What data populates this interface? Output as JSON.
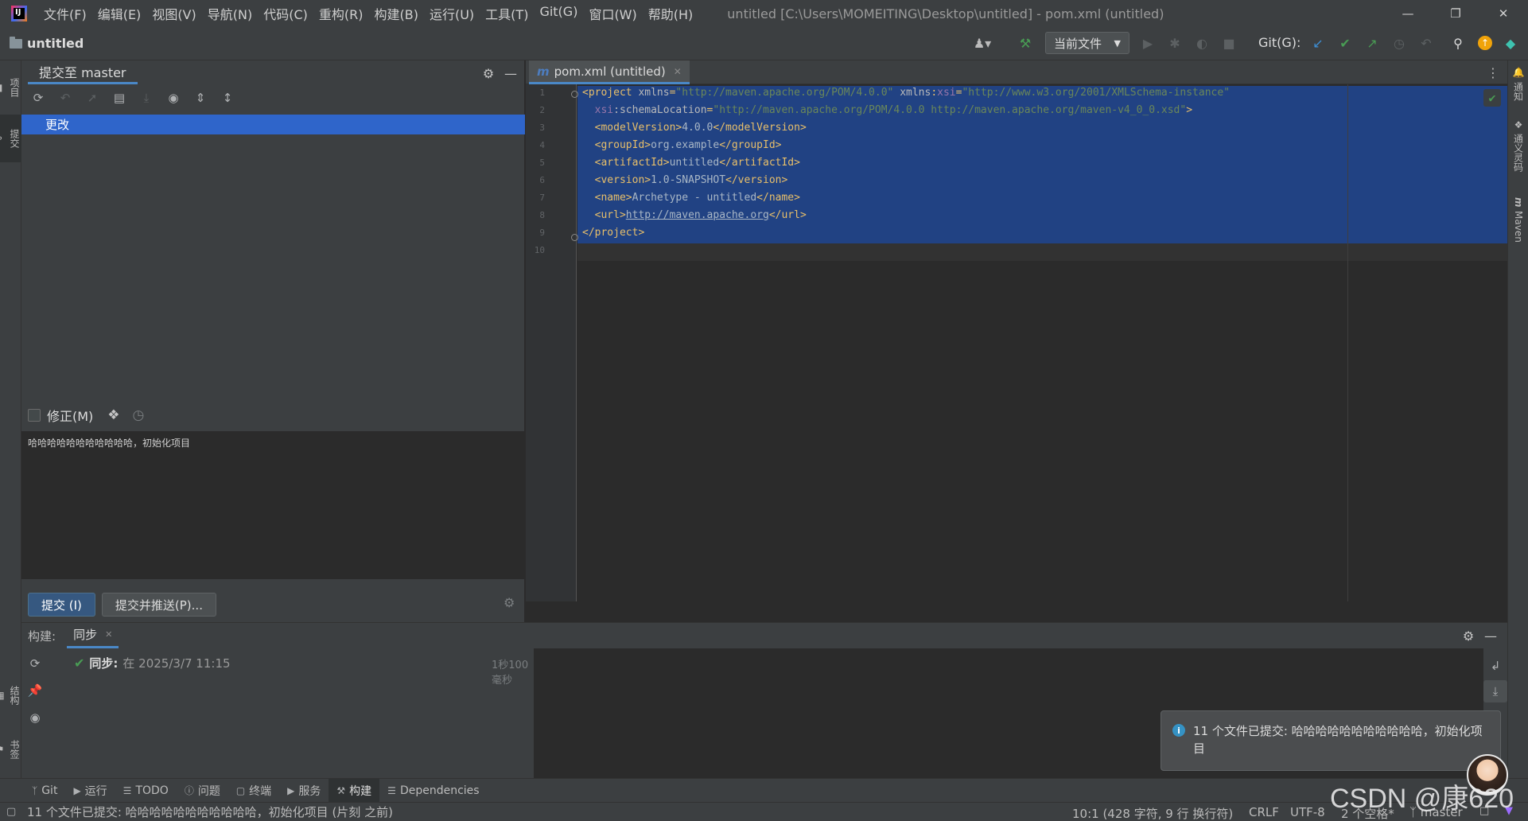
{
  "titlebar": {
    "menus": [
      "文件(F)",
      "编辑(E)",
      "视图(V)",
      "导航(N)",
      "代码(C)",
      "重构(R)",
      "构建(B)",
      "运行(U)",
      "工具(T)",
      "Git(G)",
      "窗口(W)",
      "帮助(H)"
    ],
    "window_title": "untitled [C:\\Users\\MOMEITING\\Desktop\\untitled] - pom.xml (untitled)"
  },
  "navbar": {
    "project_name": "untitled",
    "run_config": "当前文件",
    "git_label": "Git(G):"
  },
  "left_stripe": {
    "project": "项目",
    "commit": "提交",
    "structure": "结构",
    "bookmarks": "书签"
  },
  "right_stripe": {
    "notifications": "通知",
    "ai": "通义灵码",
    "maven": "Maven"
  },
  "commit_panel": {
    "tab_label": "提交至 master",
    "changes_node": "更改",
    "amend_label": "修正(M)",
    "message": "哈哈哈哈哈哈哈哈哈哈哈，初始化项目",
    "commit_button": "提交 (I)",
    "commit_push_button": "提交并推送(P)..."
  },
  "editor": {
    "tab_label": "pom.xml (untitled)",
    "tab_icon": "m",
    "line_numbers": [
      "1",
      "2",
      "3",
      "4",
      "5",
      "6",
      "7",
      "8",
      "9",
      "10"
    ]
  },
  "build_panel": {
    "title": "构建:",
    "tab_label": "同步",
    "sync_label": "同步:",
    "sync_time": "在 2025/3/7 11:15",
    "sync_duration": "1秒100毫秒"
  },
  "notification": {
    "text": "11 个文件已提交: 哈哈哈哈哈哈哈哈哈哈哈，初始化项目"
  },
  "tool_windows": {
    "git": "Git",
    "run": "运行",
    "todo": "TODO",
    "problems": "问题",
    "terminal": "终端",
    "services": "服务",
    "build": "构建",
    "dependencies": "Dependencies"
  },
  "status_bar": {
    "message": "11 个文件已提交: 哈哈哈哈哈哈哈哈哈哈哈，初始化项目 (片刻 之前)",
    "position": "10:1 (428 字符, 9 行 换行符)",
    "line_separator": "CRLF",
    "encoding": "UTF-8",
    "indent": "2 个空格*",
    "branch": "master"
  },
  "watermark": "CSDN @康620",
  "colors": {
    "accent": "#4a88c7",
    "selection": "#214283",
    "tree_selection": "#2f65ca",
    "success": "#499c54"
  }
}
